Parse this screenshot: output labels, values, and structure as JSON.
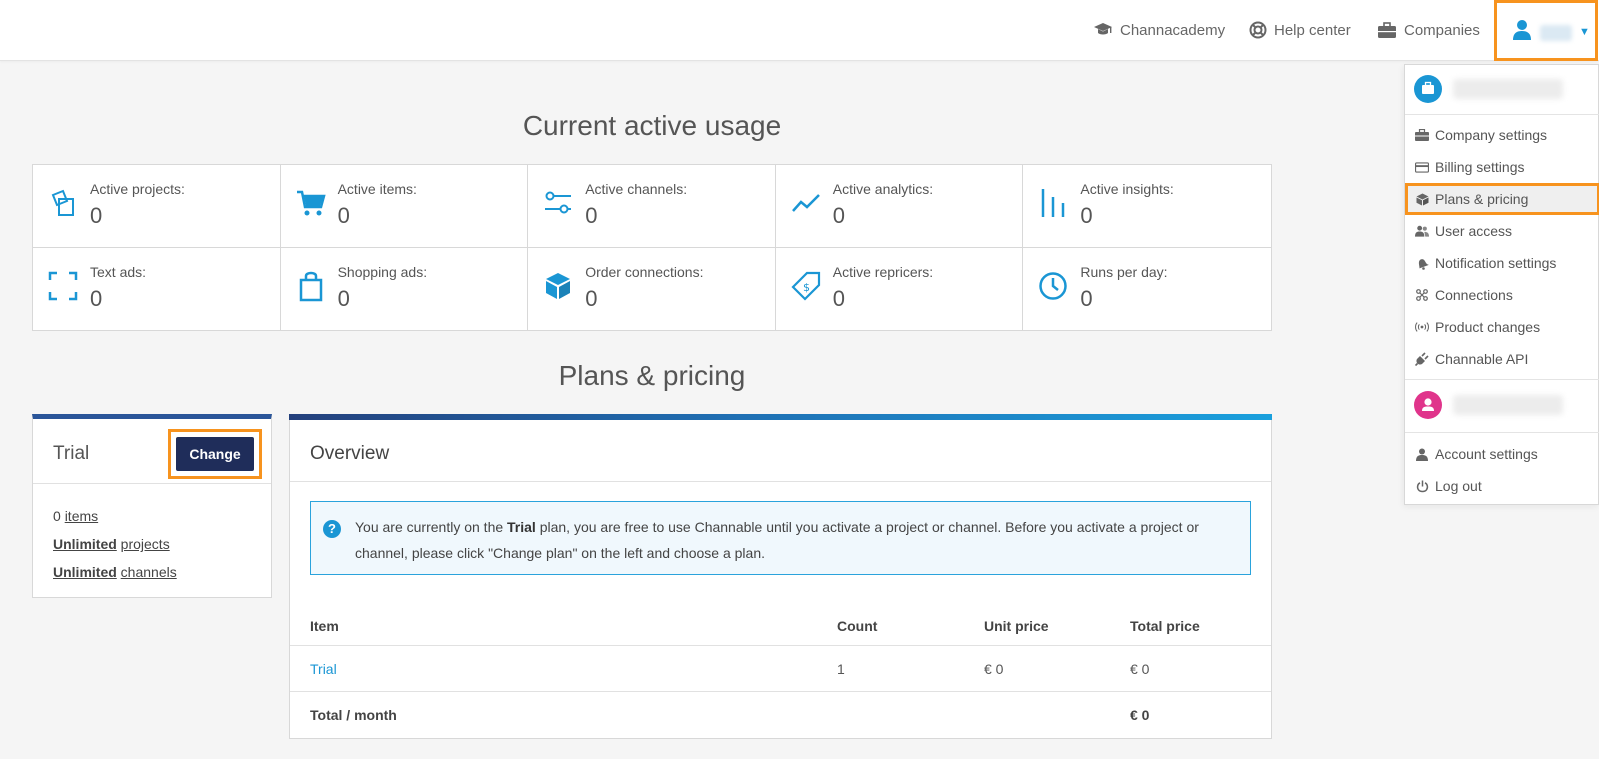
{
  "topbar": {
    "links": [
      {
        "label": "Channacademy",
        "icon": "graduation-cap-icon"
      },
      {
        "label": "Help center",
        "icon": "lifebuoy-icon"
      },
      {
        "label": "Companies",
        "icon": "briefcase-icon"
      }
    ],
    "user_menu": {
      "icon": "user-icon",
      "caret": "▼"
    }
  },
  "usage": {
    "heading": "Current active usage",
    "stats": [
      {
        "label": "Active projects:",
        "value": "0",
        "icon": "projects-icon"
      },
      {
        "label": "Active items:",
        "value": "0",
        "icon": "cart-icon"
      },
      {
        "label": "Active channels:",
        "value": "0",
        "icon": "channels-icon"
      },
      {
        "label": "Active analytics:",
        "value": "0",
        "icon": "analytics-icon"
      },
      {
        "label": "Active insights:",
        "value": "0",
        "icon": "insights-icon"
      },
      {
        "label": "Text ads:",
        "value": "0",
        "icon": "text-ads-icon"
      },
      {
        "label": "Shopping ads:",
        "value": "0",
        "icon": "shopping-bag-icon"
      },
      {
        "label": "Order connections:",
        "value": "0",
        "icon": "box-icon"
      },
      {
        "label": "Active repricers:",
        "value": "0",
        "icon": "price-tag-icon"
      },
      {
        "label": "Runs per day:",
        "value": "0",
        "icon": "clock-icon"
      }
    ]
  },
  "plans": {
    "heading": "Plans & pricing",
    "trial_card": {
      "title": "Trial",
      "change_label": "Change",
      "items_count": "0",
      "items_label": "items",
      "projects_prefix": "Unlimited",
      "projects_label": "projects",
      "channels_prefix": "Unlimited",
      "channels_label": "channels"
    },
    "overview": {
      "title": "Overview",
      "info_pre": "You are currently on the ",
      "info_bold": "Trial",
      "info_post": " plan, you are free to use Channable until you activate a project or channel. Before you activate a project or channel, please click \"Change plan\" on the left and choose a plan.",
      "columns": [
        "Item",
        "Count",
        "Unit price",
        "Total price"
      ],
      "rows": [
        {
          "item": "Trial",
          "count": "1",
          "unit_price": "€ 0",
          "total_price": "€ 0"
        }
      ],
      "total_label": "Total / month",
      "total_value": "€ 0"
    }
  },
  "dropdown": {
    "company_items": [
      {
        "label": "Company settings",
        "icon": "briefcase-icon"
      },
      {
        "label": "Billing settings",
        "icon": "credit-card-icon"
      },
      {
        "label": "Plans & pricing",
        "icon": "cube-icon",
        "active": true
      },
      {
        "label": "User access",
        "icon": "users-icon"
      },
      {
        "label": "Notification settings",
        "icon": "bell-icon"
      },
      {
        "label": "Connections",
        "icon": "connections-icon"
      },
      {
        "label": "Product changes",
        "icon": "broadcast-icon"
      },
      {
        "label": "Channable API",
        "icon": "plug-icon"
      }
    ],
    "user_items": [
      {
        "label": "Account settings",
        "icon": "user-icon"
      },
      {
        "label": "Log out",
        "icon": "power-icon"
      }
    ]
  }
}
